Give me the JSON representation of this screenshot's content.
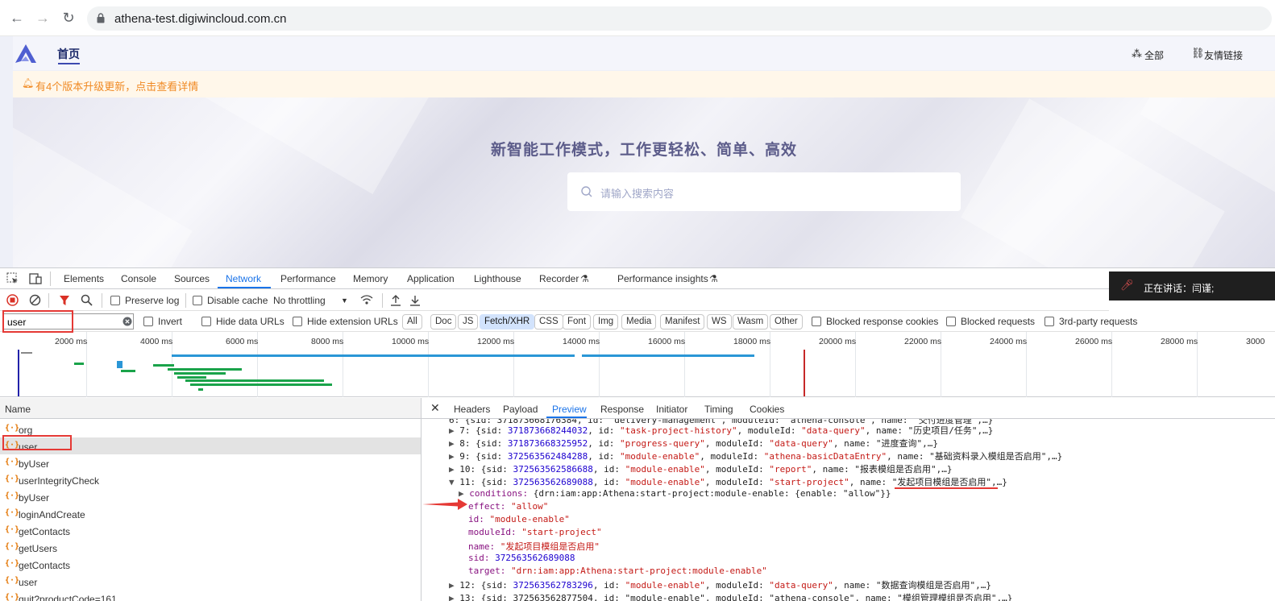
{
  "browser": {
    "url": "athena-test.digiwincloud.com.cn"
  },
  "app": {
    "nav_home": "首页",
    "header_all": "全部",
    "header_links": "友情链接",
    "notice": "有4个版本升级更新，点击查看详情",
    "hero_title": "新智能工作模式，工作更轻松、简单、高效",
    "search_placeholder": "请输入搜索内容"
  },
  "devtools": {
    "tabs": [
      "Elements",
      "Console",
      "Sources",
      "Network",
      "Performance",
      "Memory",
      "Application",
      "Lighthouse",
      "Recorder",
      "Performance insights"
    ],
    "speaking": "正在讲话：闫谨;",
    "toolbar": {
      "preserve_log": "Preserve log",
      "disable_cache": "Disable cache",
      "throttling": "No throttling"
    },
    "filter": {
      "value": "user",
      "invert": "Invert",
      "hide_data_urls": "Hide data URLs",
      "hide_extension_urls": "Hide extension URLs",
      "types": [
        "All",
        "Doc",
        "JS",
        "Fetch/XHR",
        "CSS",
        "Font",
        "Img",
        "Media",
        "Manifest",
        "WS",
        "Wasm",
        "Other"
      ],
      "active_type": "Fetch/XHR",
      "blocked_cookies": "Blocked response cookies",
      "blocked_requests": "Blocked requests",
      "third_party": "3rd-party requests"
    },
    "overview_ticks": [
      "2000 ms",
      "4000 ms",
      "6000 ms",
      "8000 ms",
      "10000 ms",
      "12000 ms",
      "14000 ms",
      "16000 ms",
      "18000 ms",
      "20000 ms",
      "22000 ms",
      "24000 ms",
      "26000 ms",
      "28000 ms",
      "3000"
    ],
    "name_header": "Name",
    "requests": [
      "org",
      "user",
      "byUser",
      "userIntegrityCheck",
      "byUser",
      "loginAndCreate",
      "getContacts",
      "getUsers",
      "getContacts",
      "user",
      "quit?productCode=161..."
    ],
    "selected_request": "user",
    "detail_tabs": [
      "Headers",
      "Payload",
      "Preview",
      "Response",
      "Initiator",
      "Timing",
      "Cookies"
    ],
    "active_detail_tab": "Preview",
    "preview": {
      "line0": "6: {sid: 371873668176384, id: \"delivery-management\", moduleId: \"athena-console\", name: \"交付进度管理\",…}",
      "line1_idx": "7:",
      "line1_sid": "371873668244032",
      "line1_id": "\"task-project-history\"",
      "line1_mod": "\"data-query\"",
      "line1_name": "\"历史项目/任务\"",
      "line2_idx": "8:",
      "line2_sid": "371873668325952",
      "line2_id": "\"progress-query\"",
      "line2_mod": "\"data-query\"",
      "line2_name": "\"进度查询\"",
      "line3_idx": "9:",
      "line3_sid": "372563562484288",
      "line3_id": "\"module-enable\"",
      "line3_mod": "\"athena-basicDataEntry\"",
      "line3_name": "\"基础资料录入模组是否启用\"",
      "line4_idx": "10:",
      "line4_sid": "372563562586688",
      "line4_id": "\"module-enable\"",
      "line4_mod": "\"report\"",
      "line4_name": "\"报表模组是否启用\"",
      "line5_idx": "11:",
      "line5_sid": "372563562689088",
      "line5_id": "\"module-enable\"",
      "line5_mod": "\"start-project\"",
      "line5_name": "\"发起项目模组是否启用\"",
      "conditions_key": "conditions:",
      "conditions_val": "{drn:iam:app:Athena:start-project:module-enable: {enable: \"allow\"}}",
      "effect_key": "effect:",
      "effect_val": "\"allow\"",
      "id_key": "id:",
      "id_val": "\"module-enable\"",
      "moduleId_key": "moduleId:",
      "moduleId_val": "\"start-project\"",
      "name_key": "name:",
      "name_val": "\"发起项目模组是否启用\"",
      "sid_key": "sid:",
      "sid_val": "372563562689088",
      "target_key": "target:",
      "target_val": "\"drn:iam:app:Athena:start-project:module-enable\"",
      "line12_idx": "12:",
      "line12_sid": "372563562783296",
      "line12_id": "\"module-enable\"",
      "line12_mod": "\"data-query\"",
      "line12_name": "\"数据查询模组是否启用\"",
      "line13": "13: {sid: 372563562877504, id: \"module-enable\", moduleId: \"athena-console\", name: \"模组管理模组是否启用\",…}"
    }
  }
}
